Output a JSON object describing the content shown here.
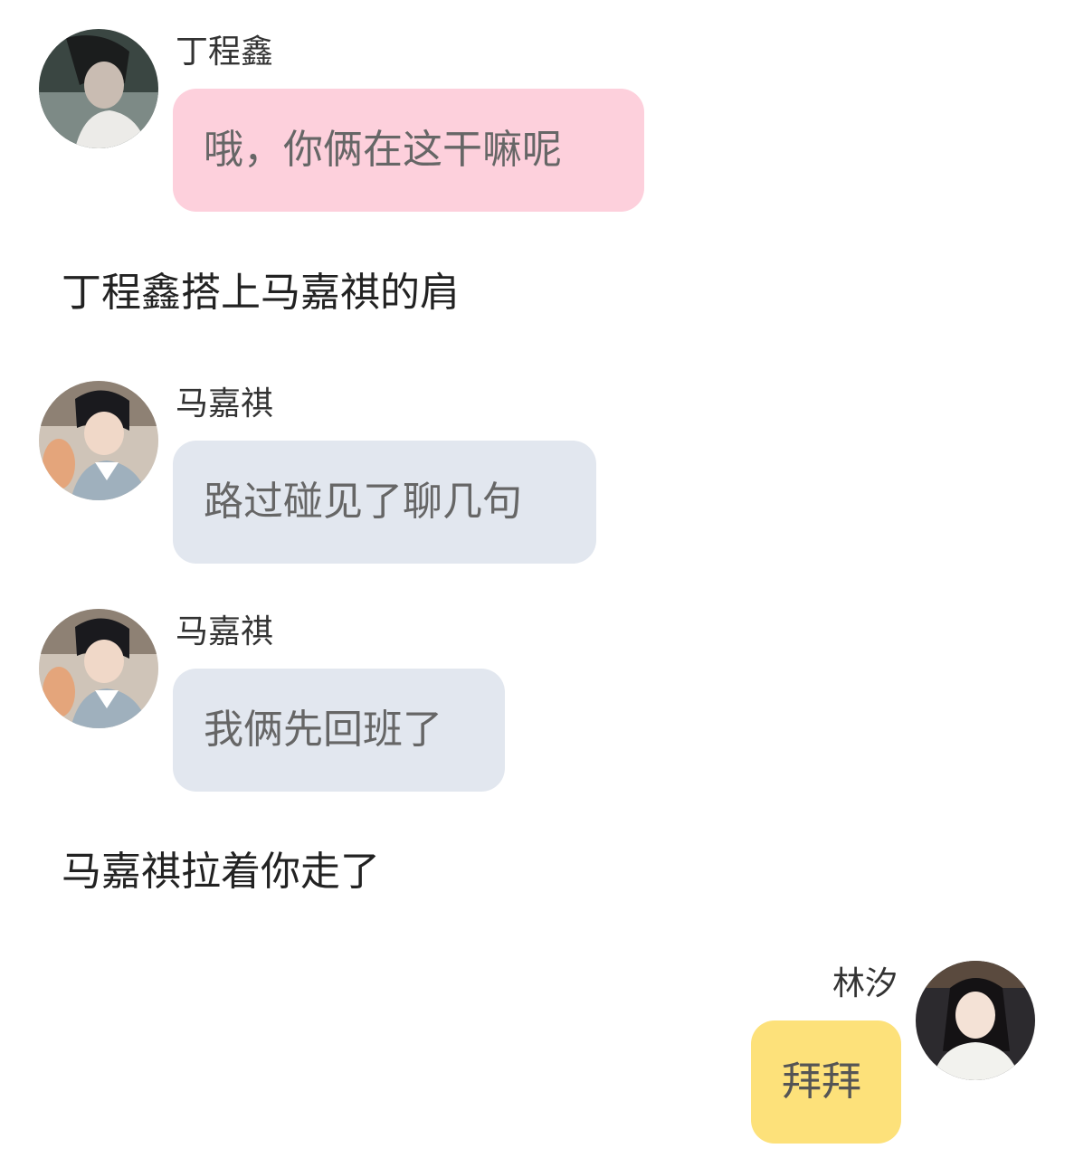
{
  "messages": [
    {
      "type": "chat",
      "side": "left",
      "speaker": "丁程鑫",
      "avatar": "boy-portrait-avatar-1",
      "text": "哦，你俩在这干嘛呢",
      "bubble_color": "#fdd0dc"
    },
    {
      "type": "narration",
      "text": "丁程鑫搭上马嘉祺的肩"
    },
    {
      "type": "chat",
      "side": "left",
      "speaker": "马嘉祺",
      "avatar": "boy-portrait-avatar-2",
      "text": "路过碰见了聊几句",
      "bubble_color": "#e2e7ef"
    },
    {
      "type": "chat",
      "side": "left",
      "speaker": "马嘉祺",
      "avatar": "boy-portrait-avatar-2",
      "text": "我俩先回班了",
      "bubble_color": "#e2e7ef"
    },
    {
      "type": "narration",
      "text": "马嘉祺拉着你走了"
    },
    {
      "type": "chat",
      "side": "right",
      "speaker": "林汐",
      "avatar": "girl-portrait-avatar",
      "text": "拜拜",
      "bubble_color": "#fde17a"
    }
  ]
}
